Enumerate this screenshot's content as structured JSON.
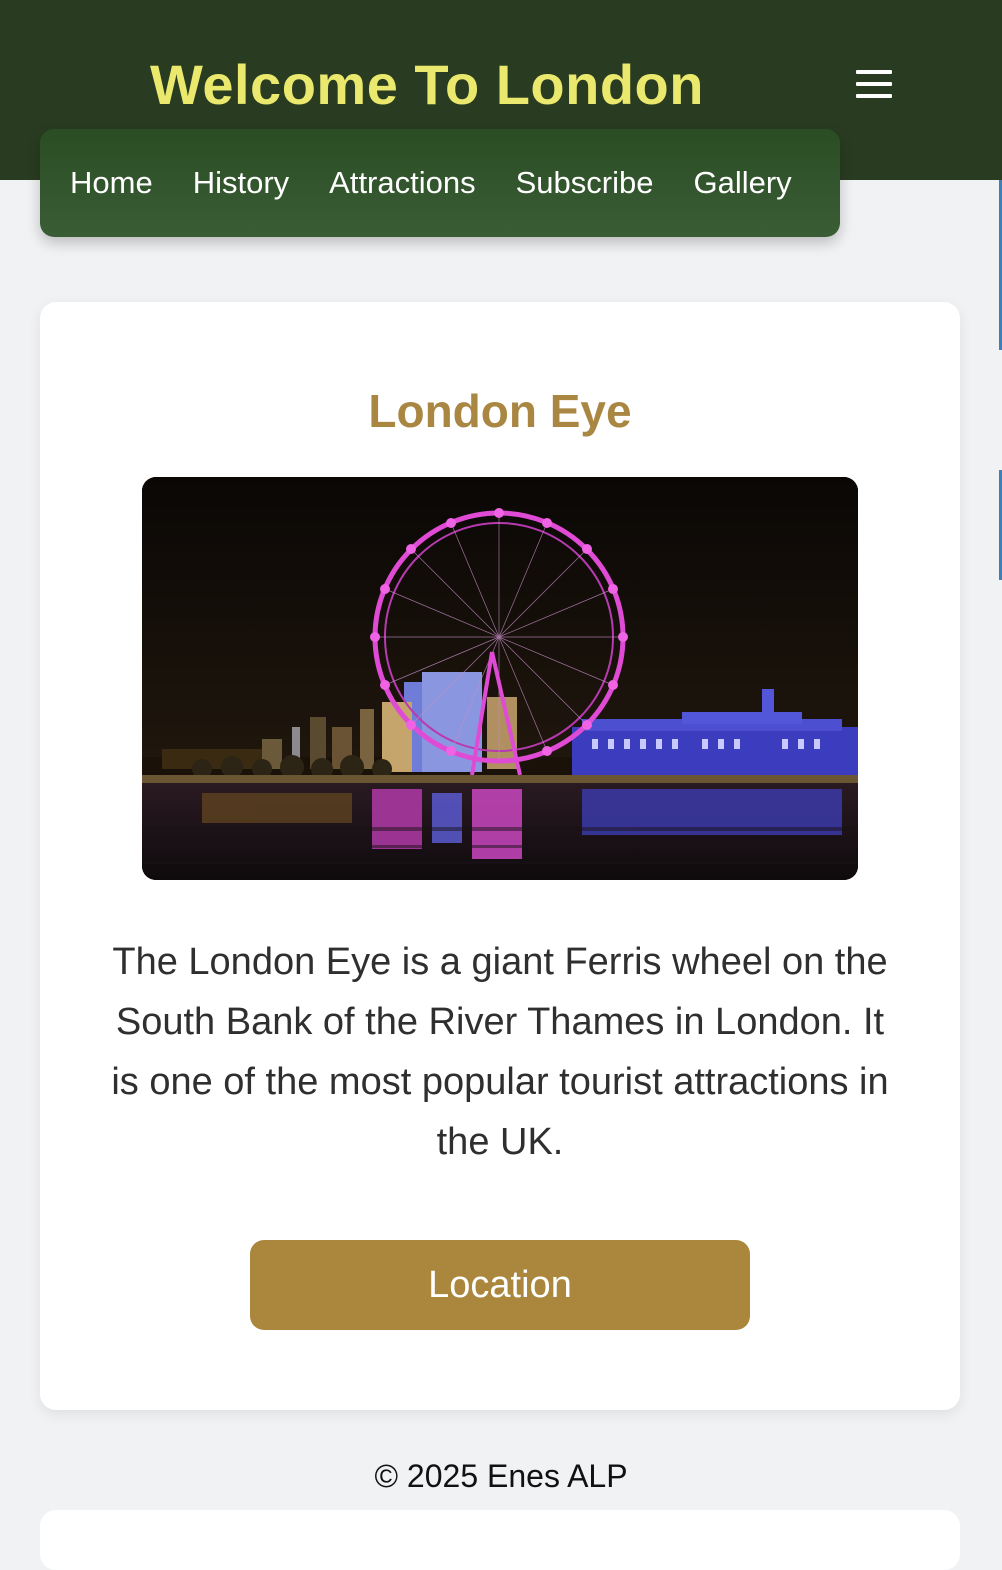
{
  "header": {
    "title": "Welcome To London",
    "menu_icon": "hamburger-menu-icon"
  },
  "nav": {
    "items": [
      {
        "label": "Home"
      },
      {
        "label": "History"
      },
      {
        "label": "Attractions"
      },
      {
        "label": "Subscribe"
      },
      {
        "label": "Gallery"
      }
    ]
  },
  "attraction": {
    "title": "London Eye",
    "image_alt": "London Eye at night",
    "description": "The London Eye is a giant Ferris wheel on the South Bank of the River Thames in London. It is one of the most popular tourist attractions in the UK.",
    "button_label": "Location"
  },
  "footer": {
    "text": "© 2025 Enes ALP"
  },
  "colors": {
    "header_bg": "#293c21",
    "title": "#eae86d",
    "nav_bg": "#2f5029",
    "accent": "#ab873e",
    "card_bg": "#ffffff",
    "page_bg": "#f1f2f4"
  }
}
